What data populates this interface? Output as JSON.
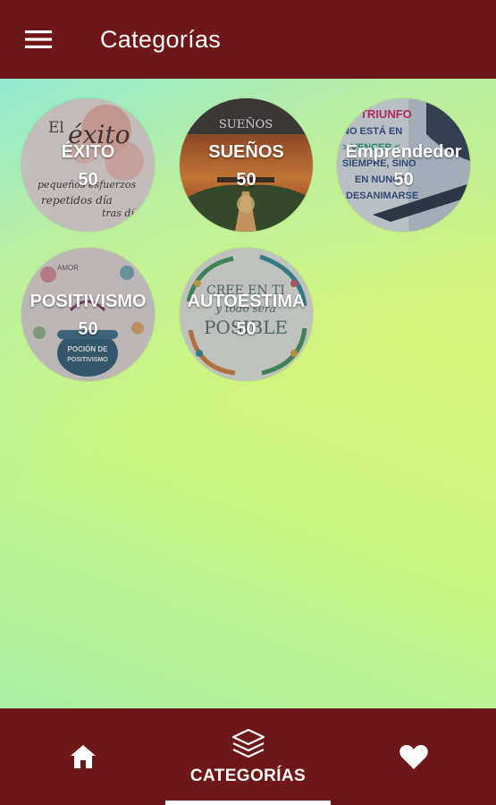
{
  "app": {
    "title": "Categorías",
    "menu_icon": "hamburger-menu-icon"
  },
  "categories": [
    {
      "name": "ÉXITO",
      "count": "50",
      "art_text": [
        "El",
        "éxito",
        "pequeños esfuerzos",
        "repetidos día",
        "tras día"
      ]
    },
    {
      "name": "SUEÑOS",
      "count": "50",
      "art_text": [
        "SUEÑOS"
      ]
    },
    {
      "name": "Emprendedor",
      "count": "50",
      "art_text": [
        "EL TRIUNFO",
        "NO ESTÁ EN",
        "> VENCER <",
        "SIEMPRE, SINO",
        "EN NUNCA",
        "DESANIMARSE"
      ]
    },
    {
      "name": "POSITIVISMO",
      "count": "50",
      "art_text": [
        "AMOR",
        "POCIÓN DE",
        "POSITIVISMO"
      ]
    },
    {
      "name": "AUTOESTIMA",
      "count": "50",
      "art_text": [
        "CREE EN TI",
        "y todo será",
        "POSIBLE"
      ]
    }
  ],
  "bottom_nav": {
    "home_icon": "home-icon",
    "categories_icon": "layers-icon",
    "categories_label": "CATEGORÍAS",
    "favorites_icon": "heart-icon",
    "active": "categories"
  },
  "colors": {
    "bar": "#6e1618",
    "text": "#ffffff"
  }
}
